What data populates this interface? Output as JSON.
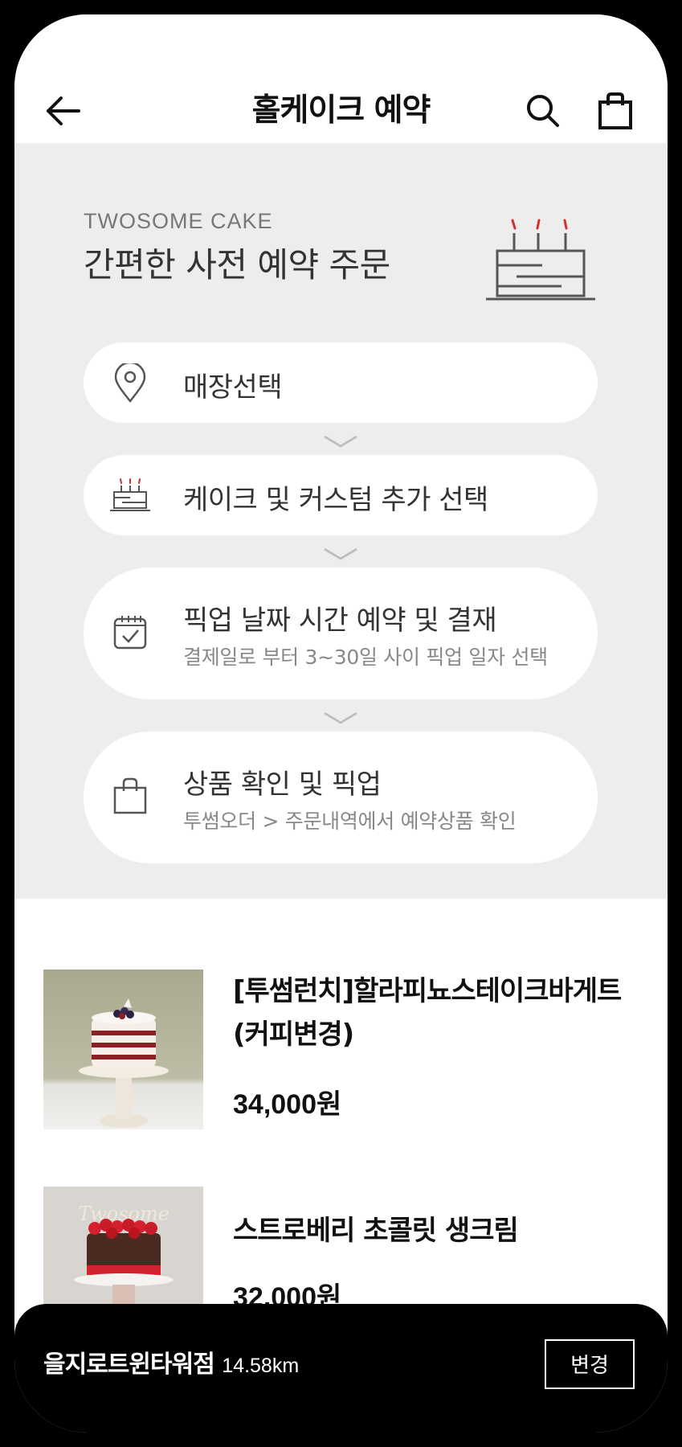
{
  "header": {
    "title": "홀케이크 예약",
    "back_icon": "arrow-left-icon",
    "search_icon": "search-icon",
    "cart_icon": "shopping-bag-icon"
  },
  "guide": {
    "brand_label": "TWOSOME CAKE",
    "headline": "간편한 사전 예약 주문",
    "hero_icon": "birthday-cake-icon",
    "steps": [
      {
        "icon": "location-pin-icon",
        "label": "매장선택"
      },
      {
        "icon": "cake-icon",
        "label": "케이크 및 커스텀 추가 선택"
      },
      {
        "icon": "calendar-check-icon",
        "label": "픽업 날짜  시간 예약 및 결재",
        "sub": "결제일로 부터 3~30일 사이 픽업 일자 선택"
      },
      {
        "icon": "shopping-bag-icon",
        "label": "상품 확인 및 픽업",
        "sub": "투썸오더 > 주문내역에서 예약상품 확인"
      }
    ]
  },
  "products": [
    {
      "name": "[투썸런치]할라피뇨스테이크바게트(커피변경)",
      "price": "34,000원"
    },
    {
      "name": "스트로베리 초콜릿 생크림",
      "price": "32,000원",
      "image_text": "Twosome"
    }
  ],
  "store_bar": {
    "store_name": "을지로트윈타워점",
    "distance": "14.58km",
    "change_label": "변경"
  },
  "colors": {
    "background_gray": "#ededed",
    "accent_red": "#d32f2f",
    "bottom_bar": "#000000"
  }
}
